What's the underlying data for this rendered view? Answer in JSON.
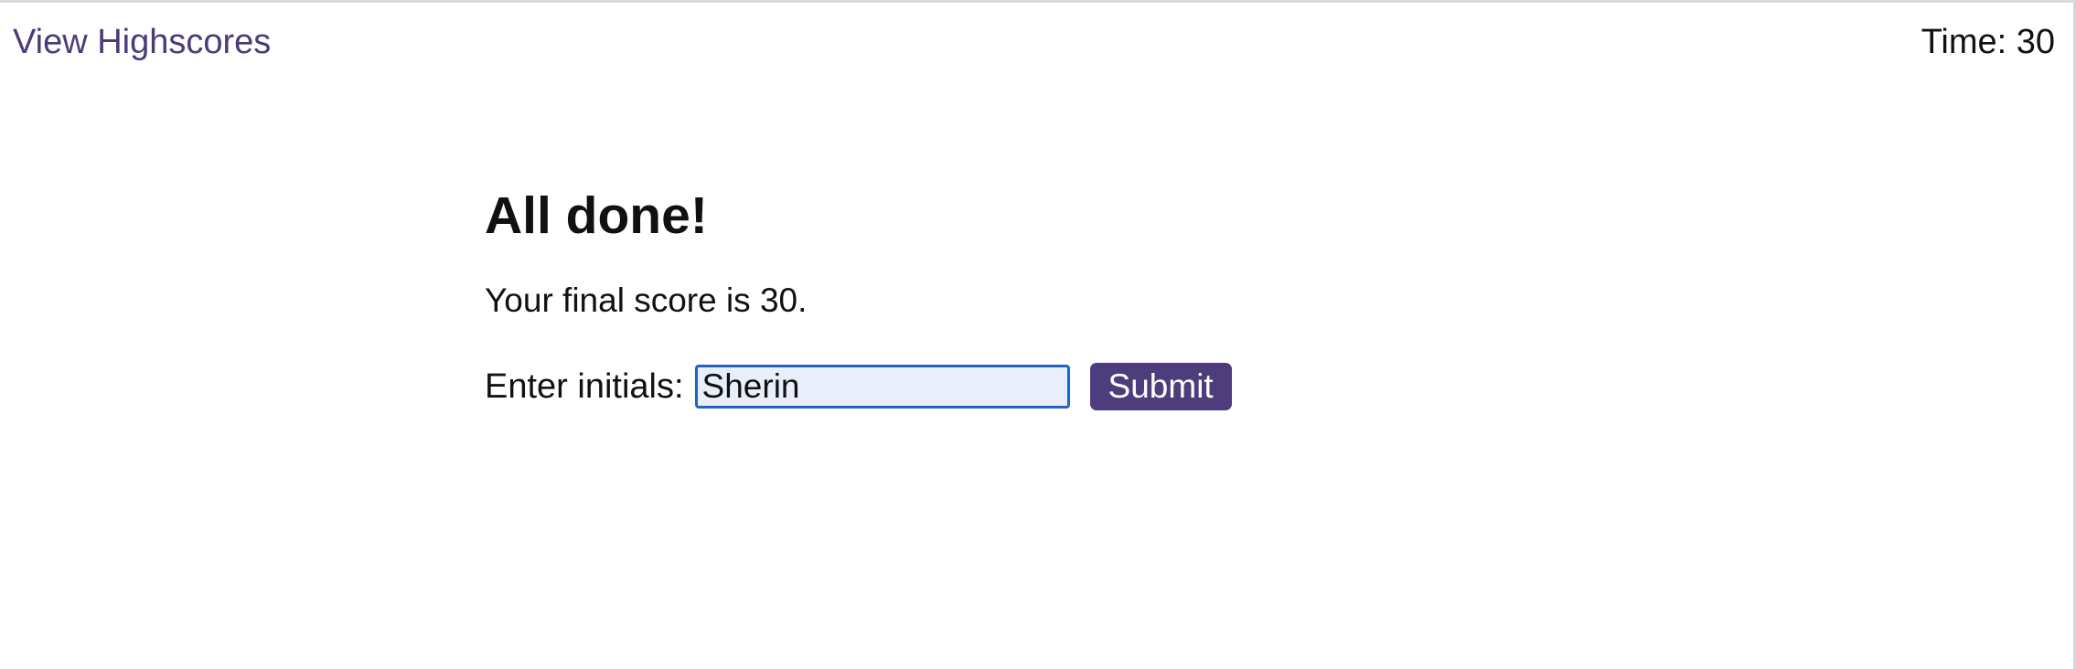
{
  "header": {
    "view_highscores_label": "View Highscores",
    "timer_text": "Time: 30"
  },
  "main": {
    "title": "All done!",
    "final_score_text": "Your final score is 30.",
    "initials_label": "Enter initials:",
    "initials_value": "Sherin",
    "submit_label": "Submit"
  },
  "colors": {
    "link": "#4b3b7a",
    "button_background": "#4e3d7c",
    "button_text": "#ffffff",
    "input_border_focus": "#2462c8",
    "input_background": "#e8effb"
  }
}
